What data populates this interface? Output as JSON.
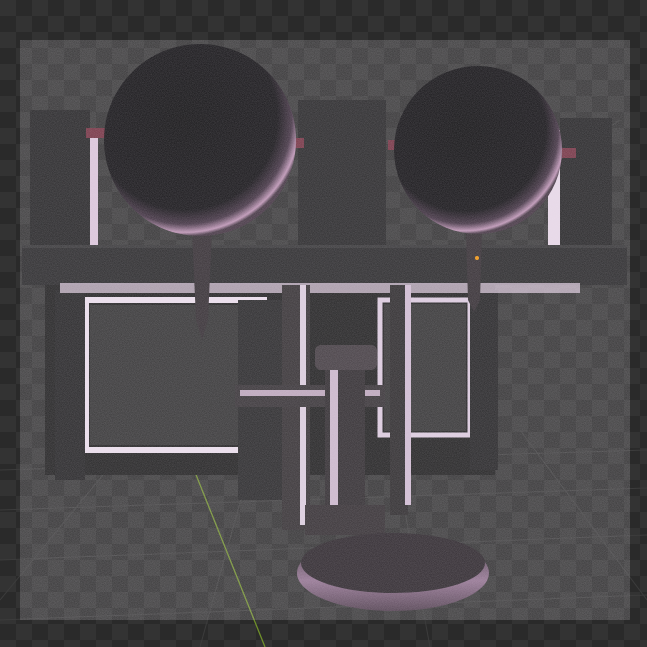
{
  "viewport": {
    "background": "#2b2b2b",
    "checker_light": "#333333",
    "checker_dark": "#2a2a2a",
    "grid_line": "#3c3c3c",
    "y_axis_color": "#6f8f2a",
    "origin_marker_color": "#f0a030"
  },
  "object": {
    "body_color": "#1c1c1e",
    "highlight_color": "#efe6f2",
    "rim_tint": "#c48fb6",
    "sphere_color": "#050506",
    "screw_tint": "#6e2a3a"
  }
}
